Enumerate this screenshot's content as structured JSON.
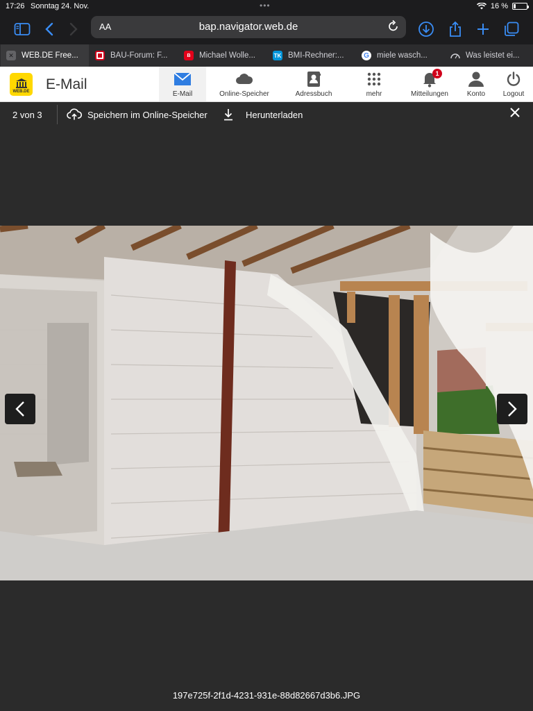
{
  "status": {
    "time": "17:26",
    "date": "Sonntag 24. Nov.",
    "battery": "16 %"
  },
  "browser": {
    "aa_label": "AA",
    "url": "bap.navigator.web.de",
    "tabs": [
      {
        "label": "WEB.DE Free...",
        "icon": "close-x",
        "active": true
      },
      {
        "label": "BAU-Forum: F...",
        "icon": "bau-forum-favicon",
        "active": false
      },
      {
        "label": "Michael Wolle...",
        "icon": "bild-favicon",
        "active": false
      },
      {
        "label": "BMI-Rechner:...",
        "icon": "tk-favicon",
        "active": false
      },
      {
        "label": "miele wasch...",
        "icon": "google-favicon",
        "active": false
      },
      {
        "label": "Was leistet ei...",
        "icon": "gauge-favicon",
        "active": false
      }
    ]
  },
  "webde": {
    "brand": "E-Mail",
    "logo_text": "WEB.DE",
    "accent": "#ffd800",
    "nav": [
      {
        "label": "E-Mail",
        "icon": "mail-icon",
        "active": true
      },
      {
        "label": "Online-Speicher",
        "icon": "cloud-icon"
      },
      {
        "label": "Adressbuch",
        "icon": "addressbook-icon"
      },
      {
        "label": "mehr",
        "icon": "grid-icon"
      },
      {
        "label": "Mitteilungen",
        "icon": "bell-icon",
        "badge": "1"
      },
      {
        "label": "Konto",
        "icon": "user-icon"
      },
      {
        "label": "Logout",
        "icon": "power-icon"
      }
    ]
  },
  "viewer": {
    "position": "2 von 3",
    "save_label": "Speichern im Online-Speicher",
    "download_label": "Herunterladen",
    "filename": "197e725f-2f1d-4231-931e-88d82667d3b6.JPG"
  }
}
